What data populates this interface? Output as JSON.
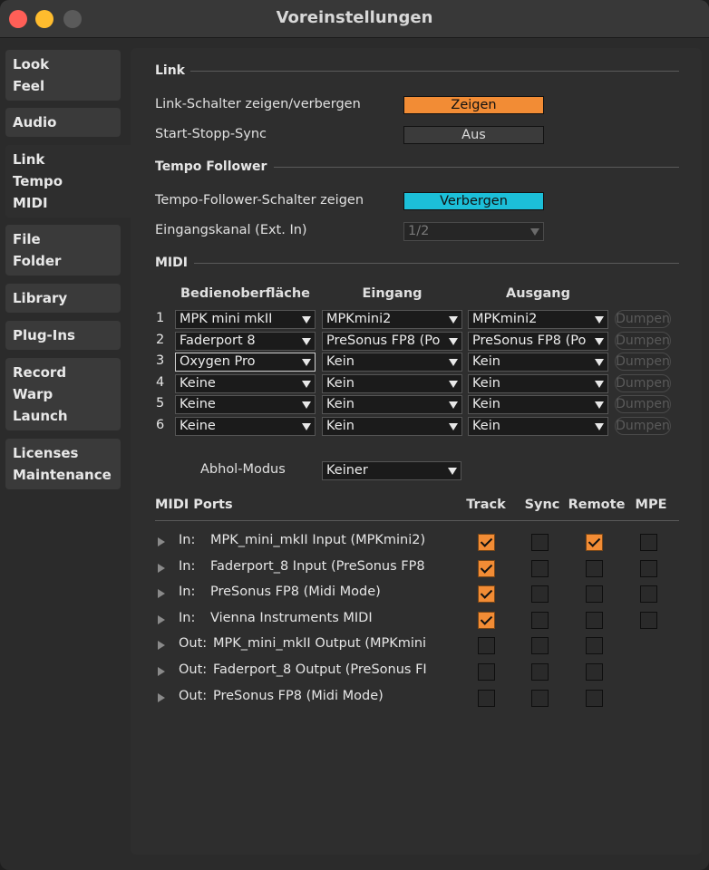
{
  "window": {
    "title": "Voreinstellungen"
  },
  "sidebar": {
    "tabs": [
      {
        "lines": [
          "Look",
          "Feel"
        ]
      },
      {
        "lines": [
          "Audio"
        ]
      },
      {
        "lines": [
          "Link",
          "Tempo",
          "MIDI"
        ],
        "active": true
      },
      {
        "lines": [
          "File",
          "Folder"
        ]
      },
      {
        "lines": [
          "Library"
        ]
      },
      {
        "lines": [
          "Plug-Ins"
        ]
      },
      {
        "lines": [
          "Record",
          "Warp",
          "Launch"
        ]
      },
      {
        "lines": [
          "Licenses",
          "Maintenance"
        ]
      }
    ]
  },
  "link": {
    "section_title": "Link",
    "toggle_label": "Link-Schalter zeigen/verbergen",
    "toggle_value": "Zeigen",
    "sync_label": "Start-Stopp-Sync",
    "sync_value": "Aus"
  },
  "tempo_follower": {
    "section_title": "Tempo Follower",
    "toggle_label": "Tempo-Follower-Schalter zeigen",
    "toggle_value": "Verbergen",
    "input_label": "Eingangskanal (Ext. In)",
    "input_value": "1/2"
  },
  "midi": {
    "section_title": "MIDI",
    "columns": {
      "surface": "Bedienoberfläche",
      "input": "Eingang",
      "output": "Ausgang"
    },
    "dump_label": "Dumpen",
    "rows": [
      {
        "num": "1",
        "surface": "MPK mini mkII",
        "input": "MPKmini2",
        "output": "MPKmini2"
      },
      {
        "num": "2",
        "surface": "Faderport 8",
        "input": "PreSonus FP8 (Po",
        "output": "PreSonus FP8 (Po"
      },
      {
        "num": "3",
        "surface": "Oxygen Pro",
        "input": "Kein",
        "output": "Kein"
      },
      {
        "num": "4",
        "surface": "Keine",
        "input": "Kein",
        "output": "Kein"
      },
      {
        "num": "5",
        "surface": "Keine",
        "input": "Kein",
        "output": "Kein"
      },
      {
        "num": "6",
        "surface": "Keine",
        "input": "Kein",
        "output": "Kein"
      }
    ],
    "pickup_label": "Abhol-Modus",
    "pickup_value": "Keiner"
  },
  "ports": {
    "title": "MIDI Ports",
    "columns": {
      "track": "Track",
      "sync": "Sync",
      "remote": "Remote",
      "mpe": "MPE"
    },
    "rows": [
      {
        "dir": "In:",
        "name": "MPK_mini_mkII Input (MPKmini2)",
        "track": true,
        "sync": false,
        "remote": true,
        "mpe": false
      },
      {
        "dir": "In:",
        "name": "Faderport_8 Input (PreSonus FP8",
        "track": true,
        "sync": false,
        "remote": false,
        "mpe": false
      },
      {
        "dir": "In:",
        "name": "PreSonus FP8 (Midi Mode)",
        "track": true,
        "sync": false,
        "remote": false,
        "mpe": false
      },
      {
        "dir": "In:",
        "name": "Vienna Instruments MIDI",
        "track": true,
        "sync": false,
        "remote": false,
        "mpe": false
      },
      {
        "dir": "Out:",
        "name": "MPK_mini_mkII Output (MPKmini",
        "track": false,
        "sync": false,
        "remote": false
      },
      {
        "dir": "Out:",
        "name": "Faderport_8 Output (PreSonus FI",
        "track": false,
        "sync": false,
        "remote": false
      },
      {
        "dir": "Out:",
        "name": "PreSonus FP8 (Midi Mode)",
        "track": false,
        "sync": false,
        "remote": false
      }
    ]
  },
  "colors": {
    "accent_orange": "#f28c35",
    "accent_cyan": "#1cbfd8",
    "panel": "#2e2e2e",
    "background": "#2b2b2b"
  }
}
